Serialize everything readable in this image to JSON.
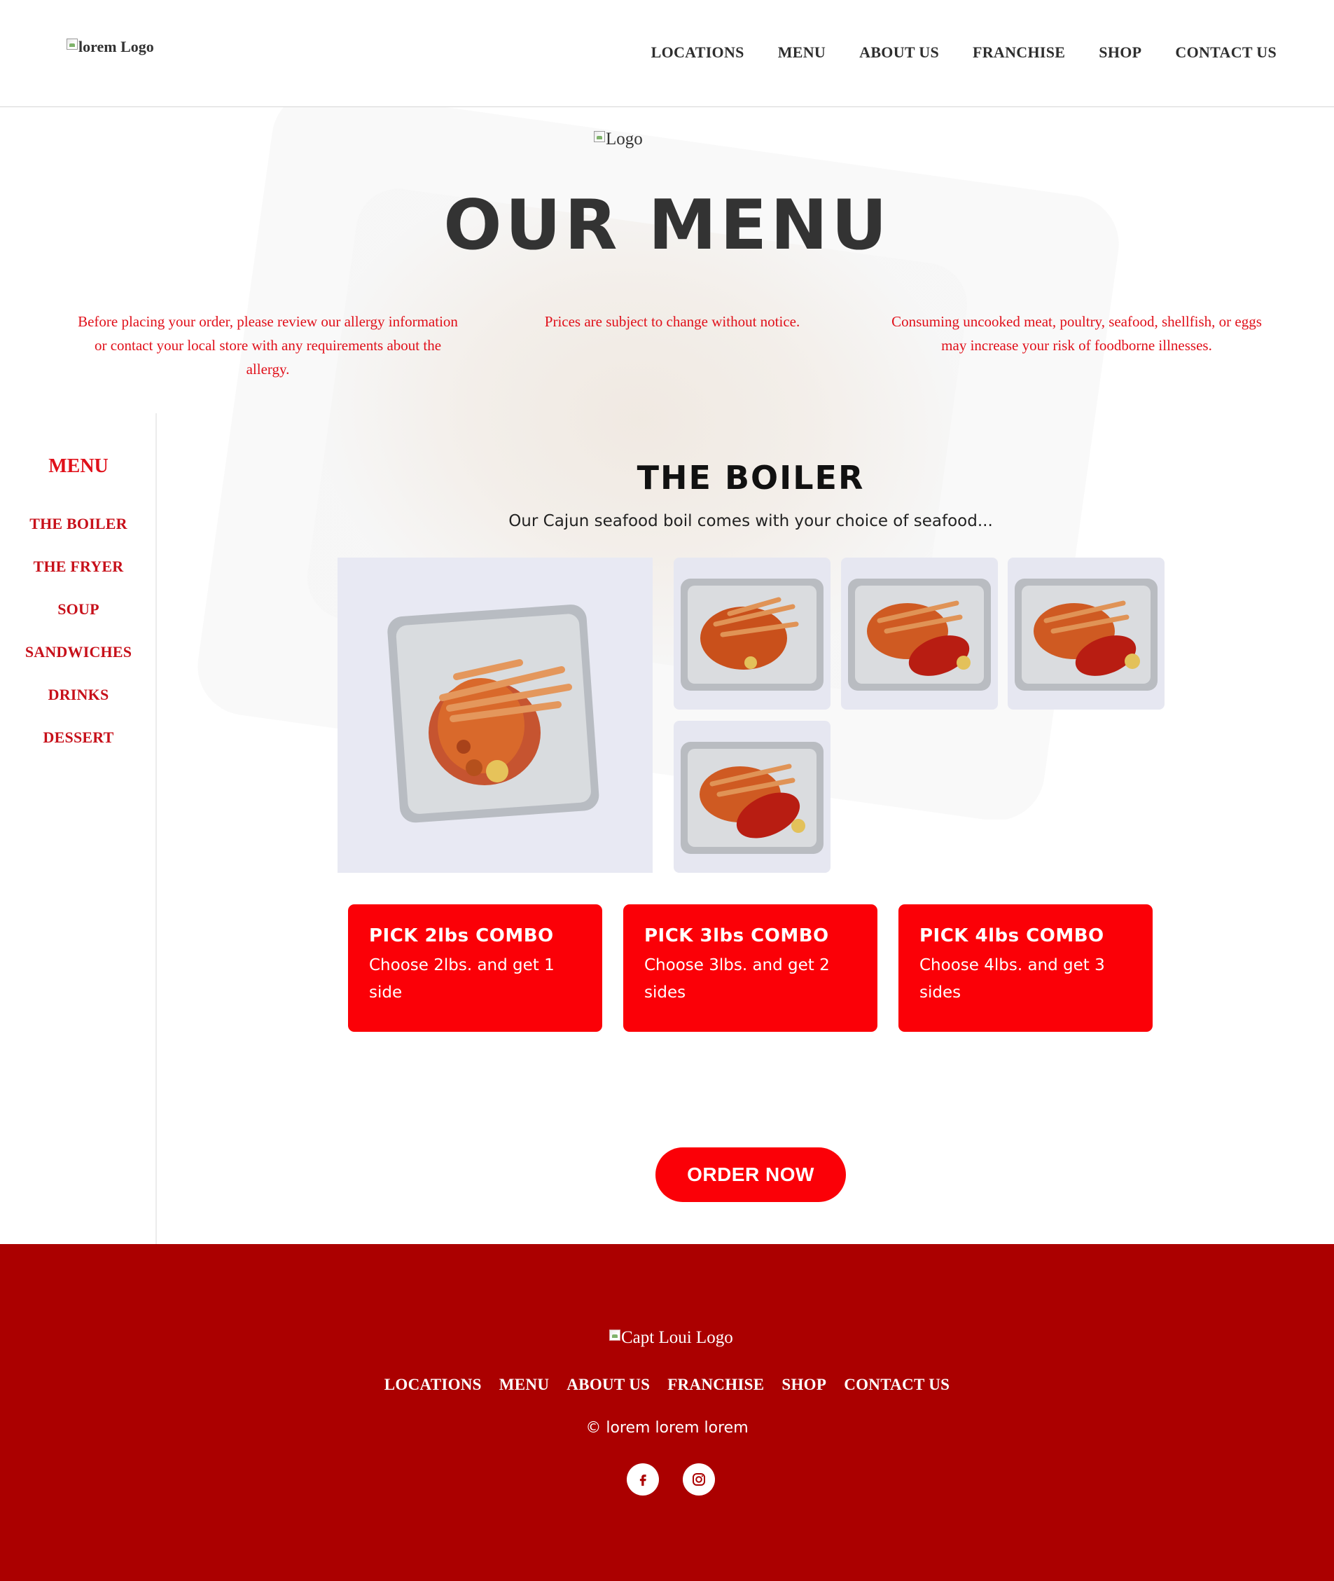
{
  "header": {
    "logo_alt": "lorem Logo",
    "nav": [
      "LOCATIONS",
      "MENU",
      "ABOUT US",
      "FRANCHISE",
      "SHOP",
      "CONTACT US"
    ]
  },
  "hero": {
    "logo_alt": "Logo",
    "title": "OUR MENU",
    "notices": [
      "Before placing your order, please review our allergy information or contact your local store with any requirements about the allergy.",
      "Prices are subject to change without notice.",
      "Consuming uncooked meat, poultry, seafood, shellfish, or eggs may increase your risk of foodborne illnesses."
    ]
  },
  "sidebar": {
    "title": "MENU",
    "items": [
      "THE BOILER",
      "THE FRYER",
      "SOUP",
      "SANDWICHES",
      "DRINKS",
      "DESSERT"
    ]
  },
  "section": {
    "title": "THE BOILER",
    "subtitle": "Our Cajun seafood boil comes with your choice of seafood...",
    "combos": [
      {
        "title": "PICK 2lbs COMBO",
        "desc": "Choose 2lbs. and get 1 side"
      },
      {
        "title": "PICK 3lbs COMBO",
        "desc": "Choose 3lbs. and get 2 sides"
      },
      {
        "title": "PICK 4lbs COMBO",
        "desc": "Choose 4lbs. and get 3 sides"
      }
    ],
    "order_label": "ORDER NOW"
  },
  "footer": {
    "logo_alt": "Capt Loui Logo",
    "nav": [
      "LOCATIONS",
      "MENU",
      "ABOUT US",
      "FRANCHISE",
      "SHOP",
      "CONTACT US"
    ],
    "copyright": "© lorem lorem lorem",
    "socials": [
      "facebook-icon",
      "instagram-icon"
    ]
  },
  "colors": {
    "accent": "#fb0007",
    "notice_text": "#e0101a",
    "footer_bg": "#ab0000",
    "heading": "#333333"
  }
}
